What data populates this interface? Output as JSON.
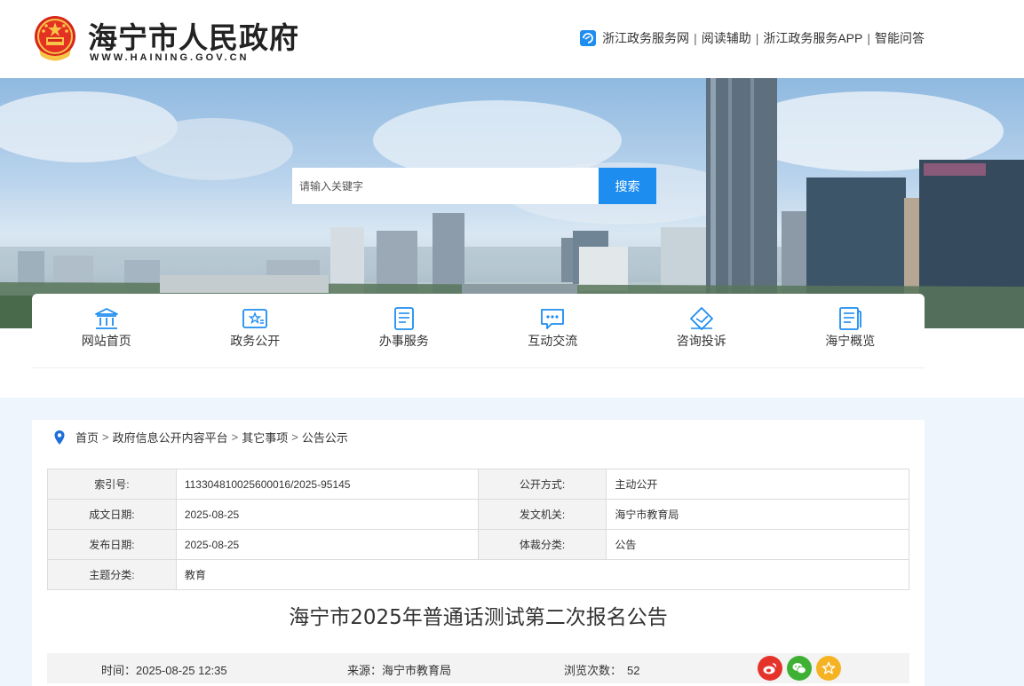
{
  "header": {
    "title": "海宁市人民政府",
    "domain": "WWW.HAINING.GOV.CN",
    "links": [
      "浙江政务服务网",
      "阅读辅助",
      "浙江政务服务APP",
      "智能问答"
    ],
    "separator": "|"
  },
  "search": {
    "placeholder": "请输入关键字",
    "button_label": "搜索"
  },
  "nav": [
    {
      "label": "网站首页",
      "icon": "building-icon"
    },
    {
      "label": "政务公开",
      "icon": "badge-icon"
    },
    {
      "label": "办事服务",
      "icon": "document-icon"
    },
    {
      "label": "互动交流",
      "icon": "chat-icon"
    },
    {
      "label": "咨询投诉",
      "icon": "envelope-icon"
    },
    {
      "label": "海宁概览",
      "icon": "book-icon"
    }
  ],
  "breadcrumb": [
    "首页",
    "政府信息公开内容平台",
    "其它事项",
    "公告公示"
  ],
  "meta": {
    "rows": [
      {
        "k1": "索引号:",
        "v1": "113304810025600016/2025-95145",
        "k2": "公开方式:",
        "v2": "主动公开"
      },
      {
        "k1": "成文日期:",
        "v1": "2025-08-25",
        "k2": "发文机关:",
        "v2": "海宁市教育局"
      },
      {
        "k1": "发布日期:",
        "v1": "2025-08-25",
        "k2": "体裁分类:",
        "v2": "公告"
      },
      {
        "k1": "主题分类:",
        "v1": "教育"
      }
    ]
  },
  "article": {
    "title": "海宁市2025年普通话测试第二次报名公告",
    "time": "时间：2025-08-25 12:35",
    "source": "来源：海宁市教育局",
    "views_label": "浏览次数：",
    "views": "52"
  },
  "colors": {
    "accent": "#1e8df0",
    "weibo": "#e6332a",
    "wechat": "#3eb135",
    "favorite": "#f5b324"
  }
}
